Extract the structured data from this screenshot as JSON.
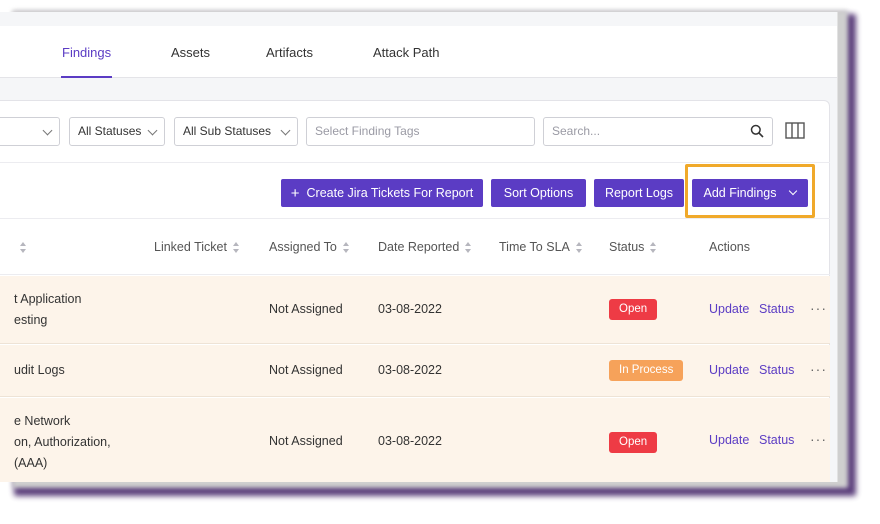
{
  "tabs": [
    {
      "label": "Findings",
      "active": true
    },
    {
      "label": "Assets",
      "active": false
    },
    {
      "label": "Artifacts",
      "active": false
    },
    {
      "label": "Attack Path",
      "active": false
    }
  ],
  "filters": {
    "status_select": "All Statuses",
    "sub_status_select": "All Sub Statuses",
    "tags_placeholder": "Select Finding Tags",
    "search_placeholder": "Search..."
  },
  "actions": {
    "create_jira": "Create Jira Tickets For Report",
    "sort_options": "Sort Options",
    "report_logs": "Report Logs",
    "add_findings": "Add Findings"
  },
  "columns": {
    "linked_ticket": "Linked Ticket",
    "assigned_to": "Assigned To",
    "date_reported": "Date Reported",
    "time_to_sla": "Time To SLA",
    "status": "Status",
    "actions": "Actions"
  },
  "rows": [
    {
      "name_lines": [
        "t Application",
        "esting"
      ],
      "assigned_to": "Not Assigned",
      "date_reported": "03-08-2022",
      "status": "Open",
      "update": "Update",
      "status_link": "Status",
      "more": "···"
    },
    {
      "name_lines": [
        "udit Logs"
      ],
      "assigned_to": "Not Assigned",
      "date_reported": "03-08-2022",
      "status": "In Process",
      "update": "Update",
      "status_link": "Status",
      "more": "···"
    },
    {
      "name_lines": [
        "e Network",
        "on, Authorization,",
        "(AAA)"
      ],
      "assigned_to": "Not Assigned",
      "date_reported": "03-08-2022",
      "status": "Open",
      "update": "Update",
      "status_link": "Status",
      "more": "···"
    }
  ],
  "colors": {
    "accent": "#5b3cc4",
    "highlight": "#f0a92a",
    "open_badge": "#ee3b45",
    "in_process_badge": "#f6a25a",
    "row_bg": "#fdf4ea"
  },
  "icons": {
    "search": "search-icon",
    "columns": "columns-icon",
    "plus": "plus-icon",
    "chevron": "chevron-down-icon",
    "sort": "sort-icon",
    "more": "more-icon"
  }
}
